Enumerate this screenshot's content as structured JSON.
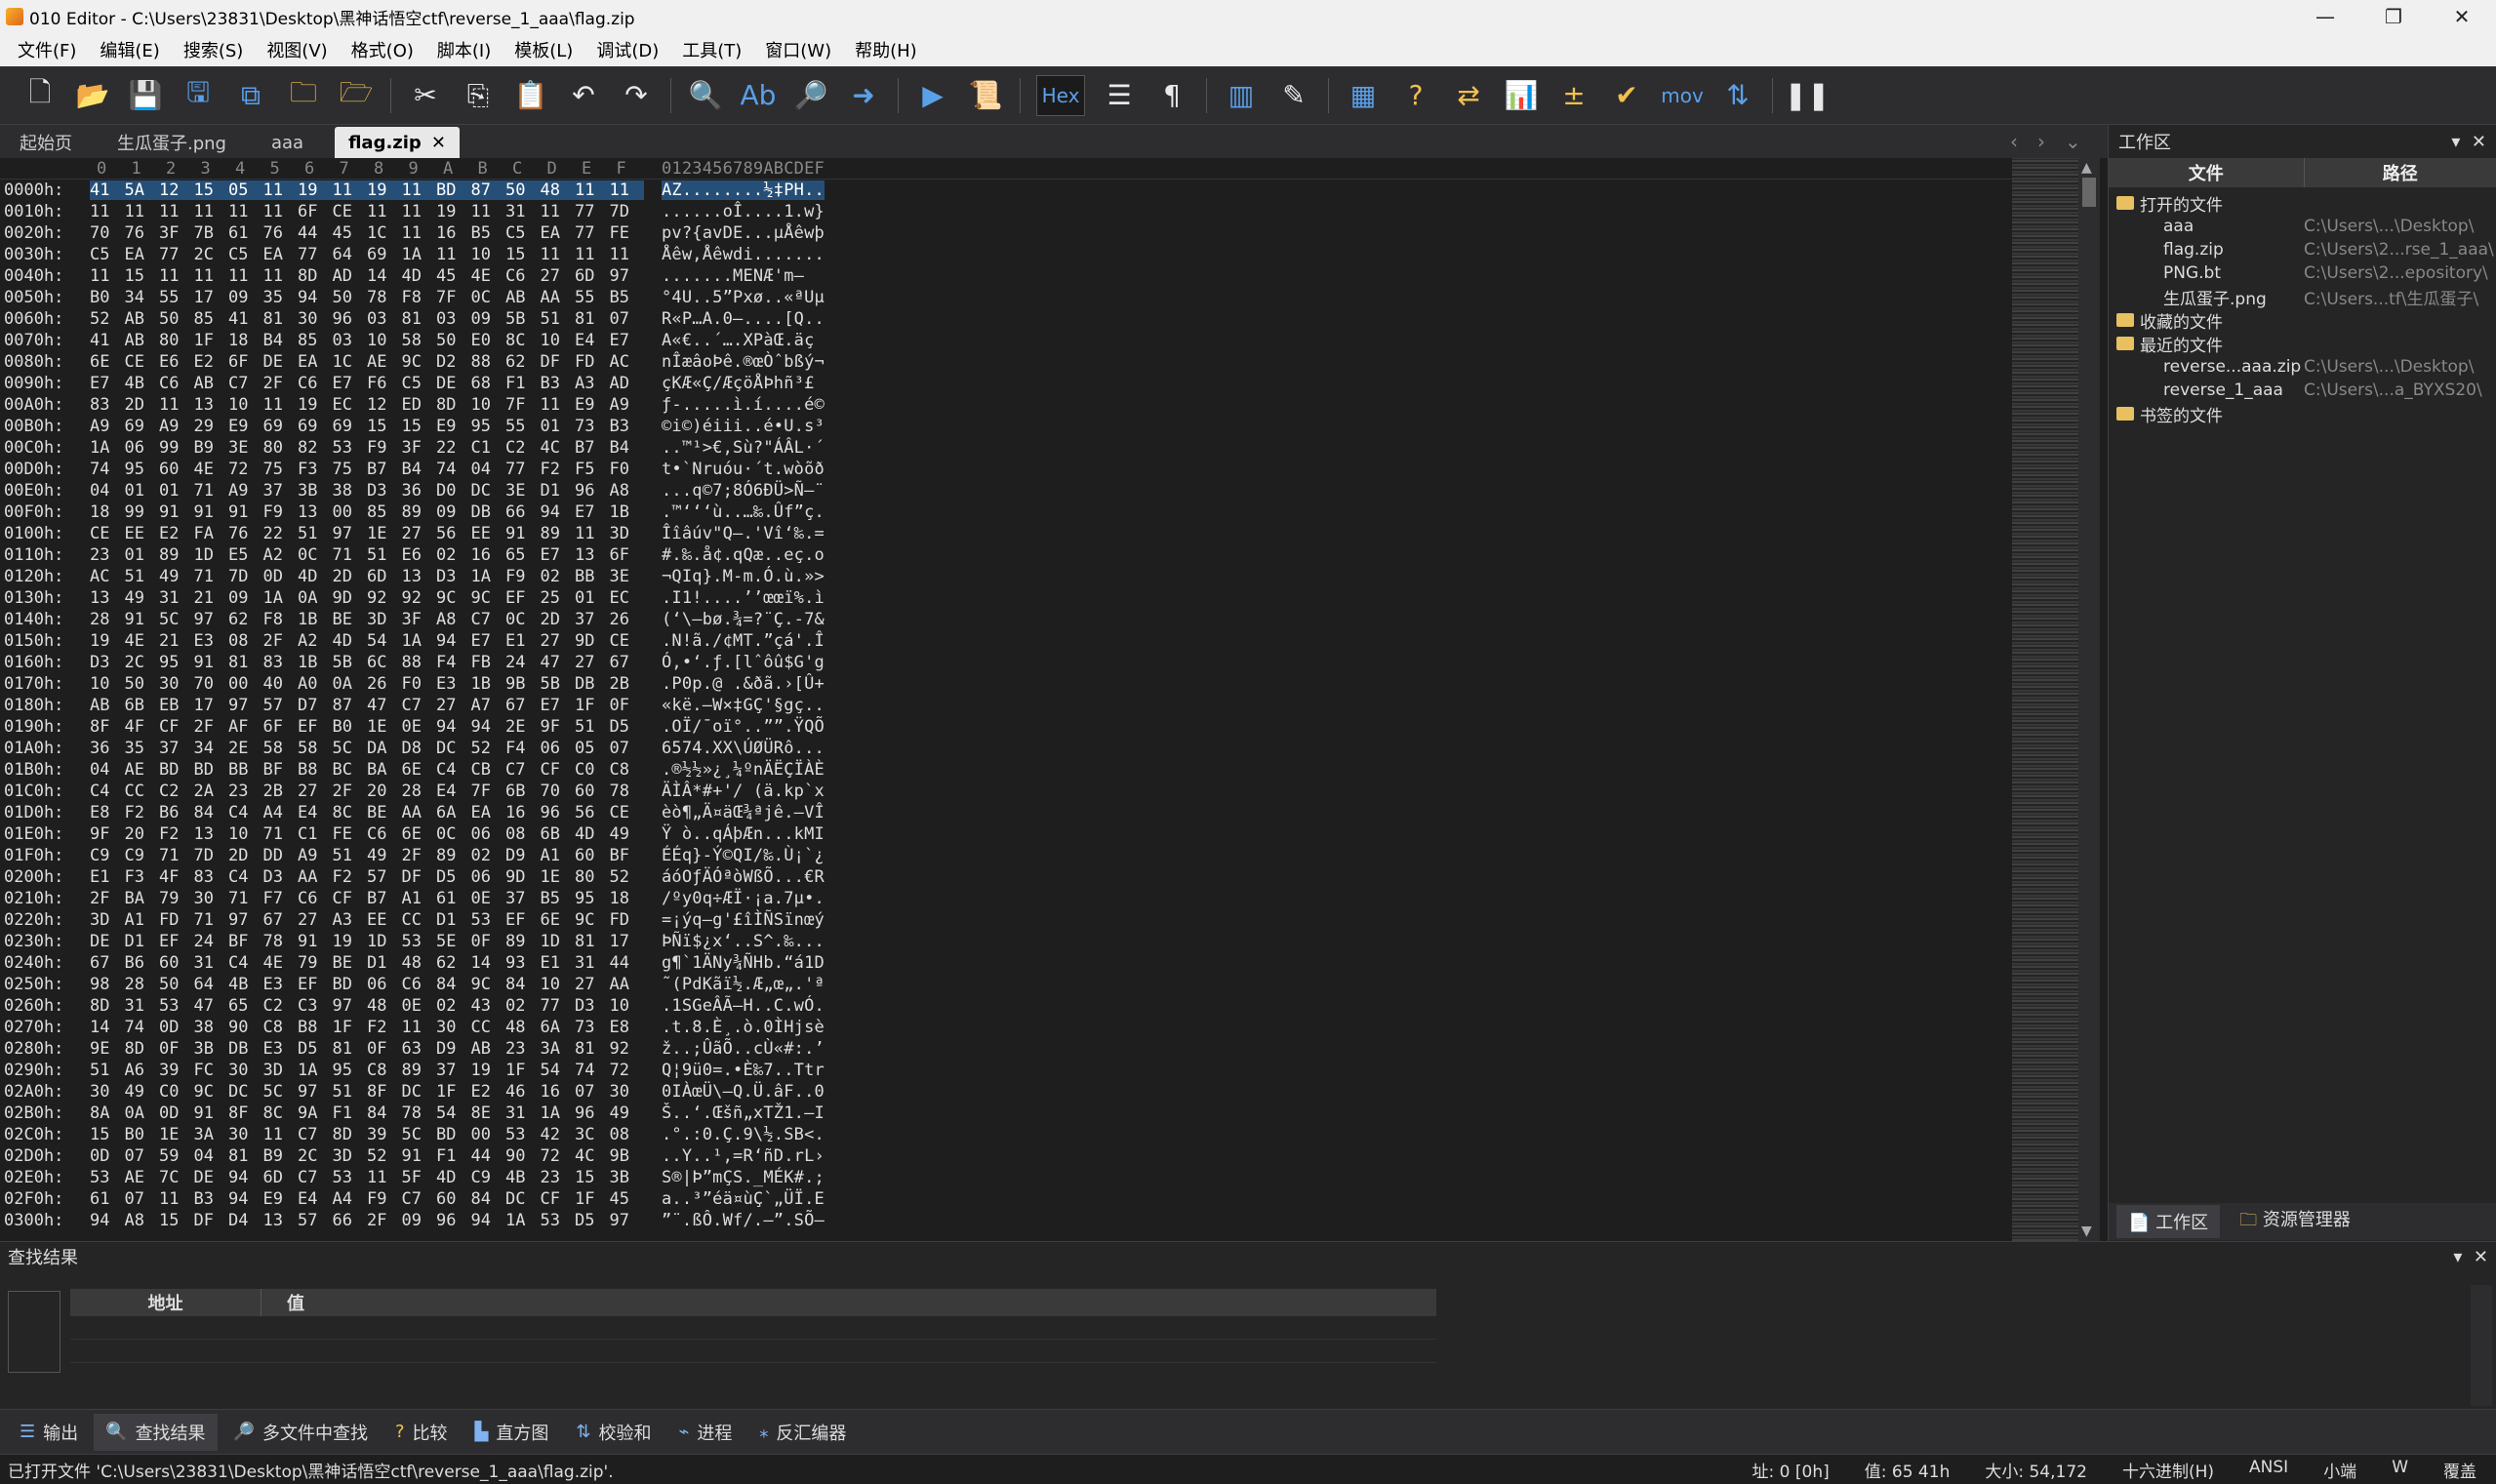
{
  "window": {
    "title": "010 Editor - C:\\Users\\23831\\Desktop\\黑神话悟空ctf\\reverse_1_aaa\\flag.zip"
  },
  "menu": [
    "文件(F)",
    "编辑(E)",
    "搜索(S)",
    "视图(V)",
    "格式(O)",
    "脚本(I)",
    "模板(L)",
    "调试(D)",
    "工具(T)",
    "窗口(W)",
    "帮助(H)"
  ],
  "toolbar": {
    "hex_label": "Hex",
    "mov_label": "mov"
  },
  "tabs": [
    {
      "label": "起始页"
    },
    {
      "label": "生瓜蛋子.png"
    },
    {
      "label": "aaa"
    },
    {
      "label": "flag.zip",
      "active": true
    }
  ],
  "hex": {
    "header_cols": [
      "0",
      "1",
      "2",
      "3",
      "4",
      "5",
      "6",
      "7",
      "8",
      "9",
      "A",
      "B",
      "C",
      "D",
      "E",
      "F"
    ],
    "ascii_header": "0123456789ABCDEF",
    "rows": [
      {
        "a": "0000h:",
        "b": "41 5A 12 15 05 11 19 11 19 11 BD 87 50 48 11 11",
        "t": "AZ........½‡PH.."
      },
      {
        "a": "0010h:",
        "b": "11 11 11 11 11 11 6F CE 11 11 19 11 31 11 77 7D",
        "t": "......oÎ....1.w}"
      },
      {
        "a": "0020h:",
        "b": "70 76 3F 7B 61 76 44 45 1C 11 16 B5 C5 EA 77 FE",
        "t": "pv?{avDE...µÅêwþ"
      },
      {
        "a": "0030h:",
        "b": "C5 EA 77 2C C5 EA 77 64 69 1A 11 10 15 11 11 11",
        "t": "Åêw,Åêwdi......."
      },
      {
        "a": "0040h:",
        "b": "11 15 11 11 11 11 8D AD 14 4D 45 4E C6 27 6D 97",
        "t": "......­.MENÆ'm—"
      },
      {
        "a": "0050h:",
        "b": "B0 34 55 17 09 35 94 50 78 F8 7F 0C AB AA 55 B5",
        "t": "°4U..5”Pxø..«ªUµ"
      },
      {
        "a": "0060h:",
        "b": "52 AB 50 85 41 81 30 96 03 81 03 09 5B 51 81 07",
        "t": "R«P…A.0–....[Q.."
      },
      {
        "a": "0070h:",
        "b": "41 AB 80 1F 18 B4 85 03 10 58 50 E0 8C 10 E4 E7",
        "t": "A«€..´….XPàŒ.äç"
      },
      {
        "a": "0080h:",
        "b": "6E CE E6 E2 6F DE EA 1C AE 9C D2 88 62 DF FD AC",
        "t": "nÎæâoÞê.®œÒˆbßý¬"
      },
      {
        "a": "0090h:",
        "b": "E7 4B C6 AB C7 2F C6 E7 F6 C5 DE 68 F1 B3 A3 AD",
        "t": "çKÆ«Ç/ÆçöÅÞhñ³£­"
      },
      {
        "a": "00A0h:",
        "b": "83 2D 11 13 10 11 19 EC 12 ED 8D 10 7F 11 E9 A9",
        "t": "ƒ-.....ì.í....é©"
      },
      {
        "a": "00B0h:",
        "b": "A9 69 A9 29 E9 69 69 69 15 15 E9 95 55 01 73 B3",
        "t": "©i©)éiii..é•U.s³"
      },
      {
        "a": "00C0h:",
        "b": "1A 06 99 B9 3E 80 82 53 F9 3F 22 C1 C2 4C B7 B4",
        "t": "..™¹>€‚Sù?\"ÁÂL·´"
      },
      {
        "a": "00D0h:",
        "b": "74 95 60 4E 72 75 F3 75 B7 B4 74 04 77 F2 F5 F0",
        "t": "t•`Nruóu·´t.wòõð"
      },
      {
        "a": "00E0h:",
        "b": "04 01 01 71 A9 37 3B 38 D3 36 D0 DC 3E D1 96 A8",
        "t": "...q©7;8Ó6ÐÜ>Ñ–¨"
      },
      {
        "a": "00F0h:",
        "b": "18 99 91 91 91 F9 13 00 85 89 09 DB 66 94 E7 1B",
        "t": ".™‘‘‘ù..…‰.Ûf”ç."
      },
      {
        "a": "0100h:",
        "b": "CE EE E2 FA 76 22 51 97 1E 27 56 EE 91 89 11 3D",
        "t": "Îîâúv\"Q—.'Vî‘‰.="
      },
      {
        "a": "0110h:",
        "b": "23 01 89 1D E5 A2 0C 71 51 E6 02 16 65 E7 13 6F",
        "t": "#.‰.å¢.qQæ..eç.o"
      },
      {
        "a": "0120h:",
        "b": "AC 51 49 71 7D 0D 4D 2D 6D 13 D3 1A F9 02 BB 3E",
        "t": "¬QIq}.M-m.Ó.ù.»>"
      },
      {
        "a": "0130h:",
        "b": "13 49 31 21 09 1A 0A 9D 92 92 9C 9C EF 25 01 EC",
        "t": ".I1!....’’œœï%.ì"
      },
      {
        "a": "0140h:",
        "b": "28 91 5C 97 62 F8 1B BE 3D 3F A8 C7 0C 2D 37 26",
        "t": "(‘\\—bø.¾=?¨Ç.-7&"
      },
      {
        "a": "0150h:",
        "b": "19 4E 21 E3 08 2F A2 4D 54 1A 94 E7 E1 27 9D CE",
        "t": ".N!ã./¢MT.”çá'.Î"
      },
      {
        "a": "0160h:",
        "b": "D3 2C 95 91 81 83 1B 5B 6C 88 F4 FB 24 47 27 67",
        "t": "Ó,•‘.ƒ.[lˆôû$G'g"
      },
      {
        "a": "0170h:",
        "b": "10 50 30 70 00 40 A0 0A 26 F0 E3 1B 9B 5B DB 2B",
        "t": ".P0p.@ .&ðã.›[Û+"
      },
      {
        "a": "0180h:",
        "b": "AB 6B EB 17 97 57 D7 87 47 C7 27 A7 67 E7 1F 0F",
        "t": "«kë.—W×‡GÇ'§gç.."
      },
      {
        "a": "0190h:",
        "b": "8F 4F CF 2F AF 6F EF B0 1E 0E 94 94 2E 9F 51 D5",
        "t": ".OÏ/¯oï°..””.ŸQÕ"
      },
      {
        "a": "01A0h:",
        "b": "36 35 37 34 2E 58 58 5C DA D8 DC 52 F4 06 05 07",
        "t": "6574.XX\\ÚØÜRô..."
      },
      {
        "a": "01B0h:",
        "b": "04 AE BD BD BB BF B8 BC BA 6E C4 CB C7 CF C0 C8",
        "t": ".®½½»¿¸¼ºnÄËÇÏÀÈ"
      },
      {
        "a": "01C0h:",
        "b": "C4 CC C2 2A 23 2B 27 2F 20 28 E4 7F 6B 70 60 78",
        "t": "ÄÌÂ*#+'/ (ä.kp`x"
      },
      {
        "a": "01D0h:",
        "b": "E8 F2 B6 84 C4 A4 E4 8C BE AA 6A EA 16 96 56 CE",
        "t": "èò¶„Ä¤äŒ¾ªjê.–VÎ"
      },
      {
        "a": "01E0h:",
        "b": "9F 20 F2 13 10 71 C1 FE C6 6E 0C 06 08 6B 4D 49",
        "t": "Ÿ ò..qÁþÆn...kMI"
      },
      {
        "a": "01F0h:",
        "b": "C9 C9 71 7D 2D DD A9 51 49 2F 89 02 D9 A1 60 BF",
        "t": "ÉÉq}-Ý©QI/‰.Ù¡`¿"
      },
      {
        "a": "0200h:",
        "b": "E1 F3 4F 83 C4 D3 AA F2 57 DF D5 06 9D 1E 80 52",
        "t": "áóOƒÄÓªòWßÕ...€R"
      },
      {
        "a": "0210h:",
        "b": "2F BA 79 30 71 F7 C6 CF B7 A1 61 0E 37 B5 95 18",
        "t": "/ºy0q÷ÆÏ·¡a.7µ•."
      },
      {
        "a": "0220h:",
        "b": "3D A1 FD 71 97 67 27 A3 EE CC D1 53 EF 6E 9C FD",
        "t": "=¡ýq—g'£îÌÑSïnœý"
      },
      {
        "a": "0230h:",
        "b": "DE D1 EF 24 BF 78 91 19 1D 53 5E 0F 89 1D 81 17",
        "t": "ÞÑï$¿x‘..S^.‰..."
      },
      {
        "a": "0240h:",
        "b": "67 B6 60 31 C4 4E 79 BE D1 48 62 14 93 E1 31 44",
        "t": "g¶`1ÄNy¾ÑHb.“á1D"
      },
      {
        "a": "0250h:",
        "b": "98 28 50 64 4B E3 EF BD 06 C6 84 9C 84 10 27 AA",
        "t": "˜(PdKãï½.Æ„œ„.'ª"
      },
      {
        "a": "0260h:",
        "b": "8D 31 53 47 65 C2 C3 97 48 0E 02 43 02 77 D3 10",
        "t": ".1SGeÂÃ—H..C.wÓ."
      },
      {
        "a": "0270h:",
        "b": "14 74 0D 38 90 C8 B8 1F F2 11 30 CC 48 6A 73 E8",
        "t": ".t.8.È¸.ò.0ÌHjsè"
      },
      {
        "a": "0280h:",
        "b": "9E 8D 0F 3B DB E3 D5 81 0F 63 D9 AB 23 3A 81 92",
        "t": "ž..;ÛãÕ..cÙ«#:.’"
      },
      {
        "a": "0290h:",
        "b": "51 A6 39 FC 30 3D 1A 95 C8 89 37 19 1F 54 74 72",
        "t": "Q¦9ü0=.•È‰7..Ttr"
      },
      {
        "a": "02A0h:",
        "b": "30 49 C0 9C DC 5C 97 51 8F DC 1F E2 46 16 07 30",
        "t": "0IÀœÜ\\—Q.Ü.âF..0"
      },
      {
        "a": "02B0h:",
        "b": "8A 0A 0D 91 8F 8C 9A F1 84 78 54 8E 31 1A 96 49",
        "t": "Š..‘.Œšñ„xTŽ1.–I"
      },
      {
        "a": "02C0h:",
        "b": "15 B0 1E 3A 30 11 C7 8D 39 5C BD 00 53 42 3C 08",
        "t": ".°.:0.Ç.9\\½.SB<."
      },
      {
        "a": "02D0h:",
        "b": "0D 07 59 04 81 B9 2C 3D 52 91 F1 44 90 72 4C 9B",
        "t": "..Y..¹,=R‘ñD.rL›"
      },
      {
        "a": "02E0h:",
        "b": "53 AE 7C DE 94 6D C7 53 11 5F 4D C9 4B 23 15 3B",
        "t": "S®|Þ”mÇS._MÉK#.;"
      },
      {
        "a": "02F0h:",
        "b": "61 07 11 B3 94 E9 E4 A4 F9 C7 60 84 DC CF 1F 45",
        "t": "a..³”éä¤ùÇ`„ÜÏ.E"
      },
      {
        "a": "0300h:",
        "b": "94 A8 15 DF D4 13 57 66 2F 09 96 94 1A 53 D5 97",
        "t": "”¨.ßÔ.Wf/.–”.SÕ—"
      }
    ]
  },
  "workspace": {
    "title": "工作区",
    "col_file": "文件",
    "col_path": "路径",
    "sections": [
      {
        "label": "打开的文件",
        "items": [
          {
            "name": "aaa",
            "path": "C:\\Users\\...\\Desktop\\"
          },
          {
            "name": "flag.zip",
            "path": "C:\\Users\\2...rse_1_aaa\\"
          },
          {
            "name": "PNG.bt",
            "path": "C:\\Users\\2...epository\\"
          },
          {
            "name": "生瓜蛋子.png",
            "path": "C:\\Users...tf\\生瓜蛋子\\"
          }
        ]
      },
      {
        "label": "收藏的文件",
        "items": []
      },
      {
        "label": "最近的文件",
        "items": [
          {
            "name": "reverse...aaa.zip",
            "path": "C:\\Users\\...\\Desktop\\"
          },
          {
            "name": "reverse_1_aaa",
            "path": "C:\\Users\\...a_BYXS20\\"
          }
        ]
      },
      {
        "label": "书签的文件",
        "items": []
      }
    ],
    "tab_workspace": "工作区",
    "tab_explorer": "资源管理器"
  },
  "find": {
    "title": "查找结果",
    "col_addr": "地址",
    "col_value": "值"
  },
  "bottom_tabs": [
    "输出",
    "查找结果",
    "多文件中查找",
    "比较",
    "直方图",
    "校验和",
    "进程",
    "反汇编器"
  ],
  "status": {
    "message": "已打开文件 'C:\\Users\\23831\\Desktop\\黑神话悟空ctf\\reverse_1_aaa\\flag.zip'.",
    "addr": "址: 0 [0h]",
    "value": "值: 65 41h",
    "size": "大小: 54,172",
    "mode": "十六进制(H)",
    "charset": "ANSI",
    "endian": "小端",
    "w": "W",
    "ovr": "覆盖"
  }
}
